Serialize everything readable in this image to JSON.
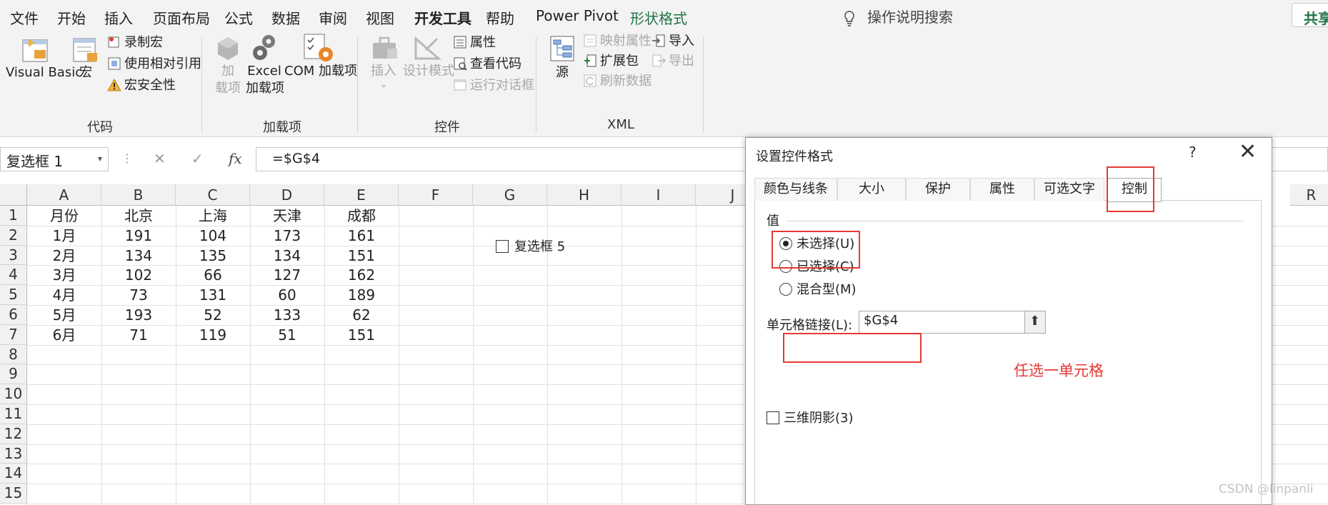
{
  "menu": {
    "items": [
      "文件",
      "开始",
      "插入",
      "页面布局",
      "公式",
      "数据",
      "审阅",
      "视图",
      "开发工具",
      "帮助",
      "Power Pivot",
      "形状格式"
    ],
    "tell_me": "操作说明搜索",
    "share": "共享"
  },
  "ribbon": {
    "code": {
      "visual_basic": "Visual Basic",
      "macros": "宏",
      "record_macro": "录制宏",
      "relative_refs": "使用相对引用",
      "macro_security": "宏安全性",
      "label": "代码"
    },
    "addins": {
      "addins_line1": "加",
      "addins_line2": "载项",
      "excel_line1": "Excel",
      "excel_line2": "加载项",
      "com": "COM 加载项",
      "label": "加载项"
    },
    "controls": {
      "insert": "插入",
      "insert_arrow": "⌄",
      "design_mode": "设计模式",
      "properties": "属性",
      "view_code": "查看代码",
      "run_dialog": "运行对话框",
      "label": "控件"
    },
    "xml": {
      "source": "源",
      "map_properties": "映射属性",
      "expansion_packs": "扩展包",
      "refresh_data": "刷新数据",
      "import": "导入",
      "export": "导出",
      "label": "XML"
    }
  },
  "formula_bar": {
    "name_box": "复选框 1",
    "name_box_arrow": "▾",
    "dots": "⋮",
    "cancel": "✕",
    "enter": "✓",
    "fx": "fx",
    "formula": "=$G$4"
  },
  "sheet": {
    "columns": [
      "A",
      "B",
      "C",
      "D",
      "E",
      "F",
      "G",
      "H",
      "I",
      "J",
      "R"
    ],
    "rows": [
      "1",
      "2",
      "3",
      "4",
      "5",
      "6",
      "7",
      "8",
      "9",
      "10",
      "11",
      "12",
      "13",
      "14",
      "15"
    ],
    "table": [
      [
        "月份",
        "北京",
        "上海",
        "天津",
        "成都"
      ],
      [
        "1月",
        "191",
        "104",
        "173",
        "161"
      ],
      [
        "2月",
        "134",
        "135",
        "134",
        "151"
      ],
      [
        "3月",
        "102",
        "66",
        "127",
        "162"
      ],
      [
        "4月",
        "73",
        "131",
        "60",
        "189"
      ],
      [
        "5月",
        "193",
        "52",
        "133",
        "62"
      ],
      [
        "6月",
        "71",
        "119",
        "51",
        "151"
      ]
    ],
    "checkbox_label": "复选框 5"
  },
  "dialog": {
    "title": "设置控件格式",
    "help": "?",
    "close": "✕",
    "tabs": [
      "颜色与线条",
      "大小",
      "保护",
      "属性",
      "可选文字",
      "控制"
    ],
    "value_label": "值",
    "radios": [
      "未选择(U)",
      "已选择(C)",
      "混合型(M)"
    ],
    "selected_radio": "未选择(U)",
    "cell_link_label": "单元格链接(L):",
    "cell_link_value": "$G$4",
    "collapse_icon": "⬆",
    "annotation": "任选一单元格",
    "threed_label": "三维阴影(3)",
    "threed_checked": false
  },
  "watermark": "CSDN @linpanli",
  "colors": {
    "accent": "#217346",
    "highlight": "#e53935"
  }
}
